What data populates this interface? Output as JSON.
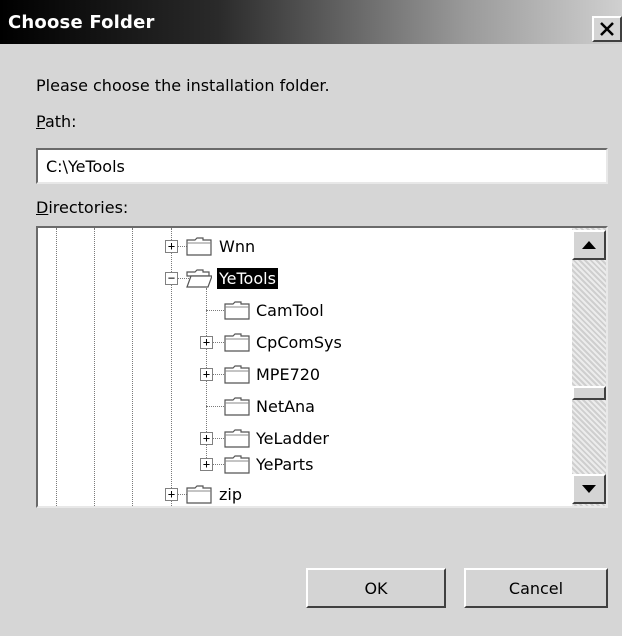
{
  "window": {
    "title": "Choose Folder",
    "close_glyph": "X"
  },
  "prompt": "Please choose the installation folder.",
  "path": {
    "label_accel": "P",
    "label_rest": "ath:",
    "value": "C:\\YeTools"
  },
  "directories": {
    "label_accel": "D",
    "label_rest": "irectories:",
    "nodes": [
      {
        "label": "Wnn",
        "expander": "+",
        "selected": false
      },
      {
        "label": "YeTools",
        "expander": "−",
        "selected": true
      },
      {
        "label": "CamTool",
        "expander": "",
        "selected": false
      },
      {
        "label": "CpComSys",
        "expander": "+",
        "selected": false
      },
      {
        "label": "MPE720",
        "expander": "+",
        "selected": false
      },
      {
        "label": "NetAna",
        "expander": "",
        "selected": false
      },
      {
        "label": "YeLadder",
        "expander": "+",
        "selected": false
      },
      {
        "label": "YeParts",
        "expander": "+",
        "selected": false
      },
      {
        "label": "zip",
        "expander": "+",
        "selected": false
      }
    ]
  },
  "buttons": {
    "ok": "OK",
    "cancel": "Cancel"
  },
  "icons": {
    "folder": "folder-icon",
    "open_folder": "folder-open-icon",
    "scroll_up": "scroll-up-arrow-icon",
    "scroll_down": "scroll-down-arrow-icon"
  },
  "colors": {
    "dialog_bg": "#d6d6d6",
    "title_bar_start": "#000000",
    "title_bar_end": "#d0d0d0",
    "selection_bg": "#000000"
  }
}
